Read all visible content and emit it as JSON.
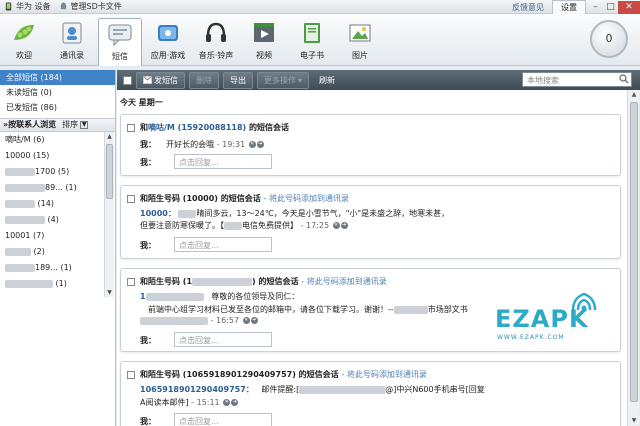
{
  "titlebar": {
    "device_label": "华为 设备",
    "sd_label": "管理SD卡文件",
    "feedback": "反馈意见",
    "settings": "设置",
    "min": "–",
    "max": "□",
    "close": "✕"
  },
  "toolbar": {
    "tools": [
      {
        "label": "欢迎",
        "icon": "pea-pod-icon"
      },
      {
        "label": "通讯录",
        "icon": "contacts-icon"
      },
      {
        "label": "短信",
        "icon": "sms-icon"
      },
      {
        "label": "应用·游戏",
        "icon": "apps-games-icon"
      },
      {
        "label": "音乐·铃声",
        "icon": "headphones-icon"
      },
      {
        "label": "视频",
        "icon": "video-icon"
      },
      {
        "label": "电子书",
        "icon": "ebook-icon"
      },
      {
        "label": "图片",
        "icon": "picture-icon"
      }
    ],
    "active_tool": "短信",
    "counter": "0"
  },
  "sidebar": {
    "categories": [
      {
        "label": "全部短信 (184)",
        "selected": true
      },
      {
        "label": "未读短信 (0)",
        "selected": false
      },
      {
        "label": "已发短信 (86)",
        "selected": false
      }
    ],
    "section_title": "»按联系人浏览",
    "sort_label": "排序",
    "contacts": [
      {
        "name": "嘀咕/M",
        "count": "(6)"
      },
      {
        "name": "10000",
        "count": "(15)"
      },
      {
        "name": "1700",
        "count": "(5)"
      },
      {
        "name": "89...",
        "count": "(1)"
      },
      {
        "name": "",
        "count": "(14)"
      },
      {
        "name": "",
        "count": "(4)"
      },
      {
        "name": "10001",
        "count": "(7)"
      },
      {
        "name": "",
        "count": "(2)"
      },
      {
        "name": "189...",
        "count": "(1)"
      },
      {
        "name": "",
        "count": "(1)"
      }
    ]
  },
  "actionbar": {
    "send": "发短信",
    "delete": "删除",
    "export": "导出",
    "more": "更多操作",
    "refresh": "刷新",
    "search_placeholder": "本地搜索"
  },
  "main": {
    "day": "今天  星期一",
    "reply_placeholder": "点击回复...",
    "me_label": "我：",
    "add_to_contacts": "- 将此号码添加到通讯录",
    "card1": {
      "prefix": "和",
      "name": "嘀咕/M (15920088118)",
      "suffix": "的短信会话",
      "msg": "开好长的会哦",
      "time": "- 19:31"
    },
    "card2": {
      "title": "和陌生号码 (10000) 的短信会话",
      "sender": "10000：",
      "msg1": "晴间多云，13～24℃，今天是小雪节气，\"小\"是未盛之辞，地寒未甚，",
      "msg2a": "但要注意防寒保暖了。【",
      "msg2b": "电信免费提供】",
      "time": "- 17:25"
    },
    "card3": {
      "title_a": "和陌生号码 (1",
      "title_b": ") 的短信会话",
      "sender": "1",
      "msg1": "尊敬的各位领导及同仁：",
      "msg2a": "前端中心组学习材料已发至各位的邮箱中，请各位下载学习。谢谢！--",
      "msg2b": "市场部文书",
      "time": "- 16:57"
    },
    "card4": {
      "title": "和陌生号码 (1065918901290409757) 的短信会话",
      "sender": "1065918901290409757：",
      "msg1a": "邮件提醒:[",
      "msg1b": "@]中兴N600手机串号[回复",
      "msg2": "A阅读本邮件]",
      "time": "- 15:11"
    }
  },
  "watermark": {
    "brand": "EZAPK",
    "url": "WWW.EZAPK.COM"
  }
}
